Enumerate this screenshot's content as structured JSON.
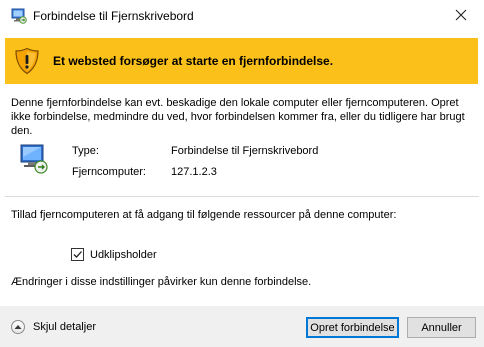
{
  "window": {
    "title": "Forbindelse til Fjernskrivebord"
  },
  "banner": {
    "message": "Et websted forsøger at starte en fjernforbindelse."
  },
  "description": "Denne fjernforbindelse kan evt. beskadige den lokale computer eller fjerncomputeren. Opret ikke forbindelse, medmindre du ved, hvor forbindelsen kommer fra, eller du tidligere har brugt den.",
  "connection_info": {
    "type_label": "Type:",
    "type_value": "Forbindelse til Fjernskrivebord",
    "remote_label": "Fjerncomputer:",
    "remote_value": "127.1.2.3"
  },
  "resources": {
    "intro": "Tillad fjerncomputeren at få adgang til følgende ressourcer på denne computer:",
    "clipboard_label": "Udklipsholder",
    "clipboard_checked": true
  },
  "changes_note": "Ændringer i disse indstillinger påvirker kun denne forbindelse.",
  "footer": {
    "details_label": "Skjul detaljer",
    "connect_label": "Opret forbindelse",
    "cancel_label": "Annuller"
  },
  "colors": {
    "banner": "#fcc01a",
    "footer": "#f0f0f0",
    "accent": "#0078d7"
  }
}
